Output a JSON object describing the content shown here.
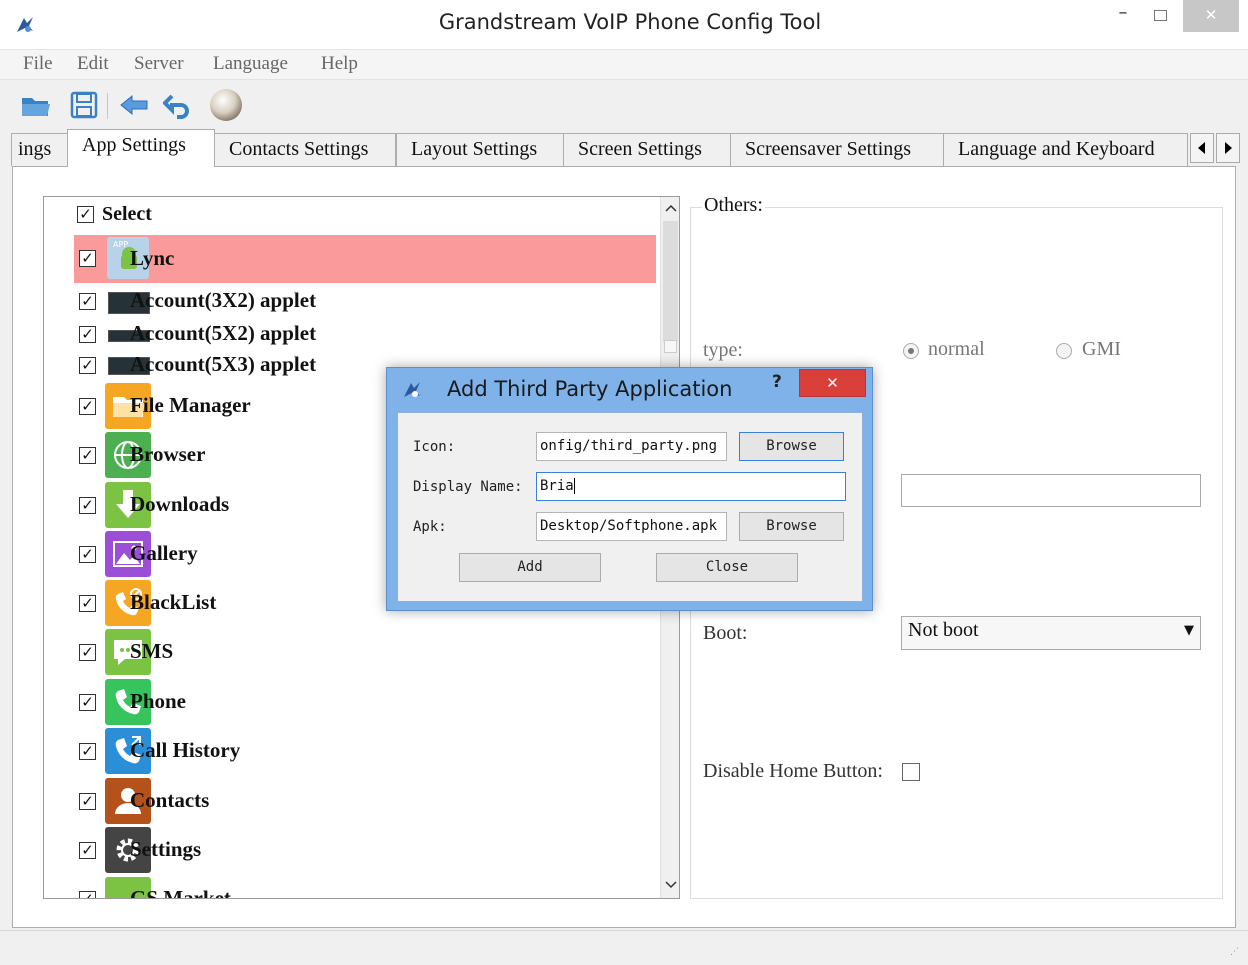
{
  "window": {
    "title": "Grandstream VoIP Phone Config Tool",
    "minimize_glyph": "–",
    "close_glyph": "✕"
  },
  "menu": [
    "File",
    "Edit",
    "Server",
    "Language",
    "Help"
  ],
  "toolbar": {
    "icons": [
      "open-folder-icon",
      "save-icon",
      "back-arrow-icon",
      "undo-icon",
      "sphere-icon"
    ]
  },
  "tabs": [
    {
      "label": "ings"
    },
    {
      "label": "App Settings",
      "active": true
    },
    {
      "label": "Contacts Settings"
    },
    {
      "label": "Layout Settings"
    },
    {
      "label": "Screen Settings"
    },
    {
      "label": "Screensaver Settings"
    },
    {
      "label": "Language and Keyboard"
    }
  ],
  "app_list": {
    "select_all_label": "Select",
    "select_all_checked": true,
    "items": [
      {
        "label": "Lync",
        "checked": true,
        "selected": true,
        "icon": "android-app-icon",
        "color": "#a0c4e0"
      },
      {
        "label": "Account(3X2) applet",
        "checked": true,
        "icon": "applet-icon"
      },
      {
        "label": "Account(5X2) applet",
        "checked": true,
        "icon": "applet-icon"
      },
      {
        "label": "Account(5X3) applet",
        "checked": true,
        "icon": "applet-icon"
      },
      {
        "label": "File Manager",
        "checked": true,
        "icon": "folder-icon",
        "color": "#f5a623"
      },
      {
        "label": "Browser",
        "checked": true,
        "icon": "globe-icon",
        "color": "#4caf50"
      },
      {
        "label": "Downloads",
        "checked": true,
        "icon": "download-icon",
        "color": "#7cc243"
      },
      {
        "label": "Gallery",
        "checked": true,
        "icon": "gallery-icon",
        "color": "#9c4fd6"
      },
      {
        "label": "BlackList",
        "checked": true,
        "icon": "blocked-phone-icon",
        "color": "#f5a623"
      },
      {
        "label": "SMS",
        "checked": true,
        "icon": "message-icon",
        "color": "#7cc243"
      },
      {
        "label": "Phone",
        "checked": true,
        "icon": "phone-icon",
        "color": "#37c45d"
      },
      {
        "label": "Call History",
        "checked": true,
        "icon": "call-history-icon",
        "color": "#2b8fd8"
      },
      {
        "label": "Contacts",
        "checked": true,
        "icon": "contact-icon",
        "color": "#b5521b"
      },
      {
        "label": "Settings",
        "checked": true,
        "icon": "gear-icon",
        "color": "#444444"
      },
      {
        "label": "GS Market",
        "checked": true,
        "icon": "android-icon",
        "color": "#7cc243"
      }
    ]
  },
  "others": {
    "legend": "Others:",
    "type_label": "type:",
    "type_options": [
      {
        "label": "normal",
        "selected": true
      },
      {
        "label": "GMI",
        "selected": false
      }
    ],
    "boot_label": "Boot:",
    "boot_value": "Not boot",
    "disable_home_label": "Disable Home Button:",
    "disable_home_checked": false
  },
  "dialog": {
    "title": "Add Third Party Application",
    "help": "?",
    "close_glyph": "✕",
    "icon_label": "Icon:",
    "icon_value": "onfig/third_party.png",
    "display_name_label": "Display Name:",
    "display_name_value": "Bria",
    "apk_label": "Apk:",
    "apk_value": "Desktop/Softphone.apk",
    "browse_label": "Browse",
    "add_label": "Add",
    "close_label": "Close"
  },
  "colors": {
    "selected_row": "#fb9a9a",
    "dialog_frame": "#7fb2e8",
    "dialog_close": "#d9403a",
    "focus_border": "#3c7fd8"
  }
}
